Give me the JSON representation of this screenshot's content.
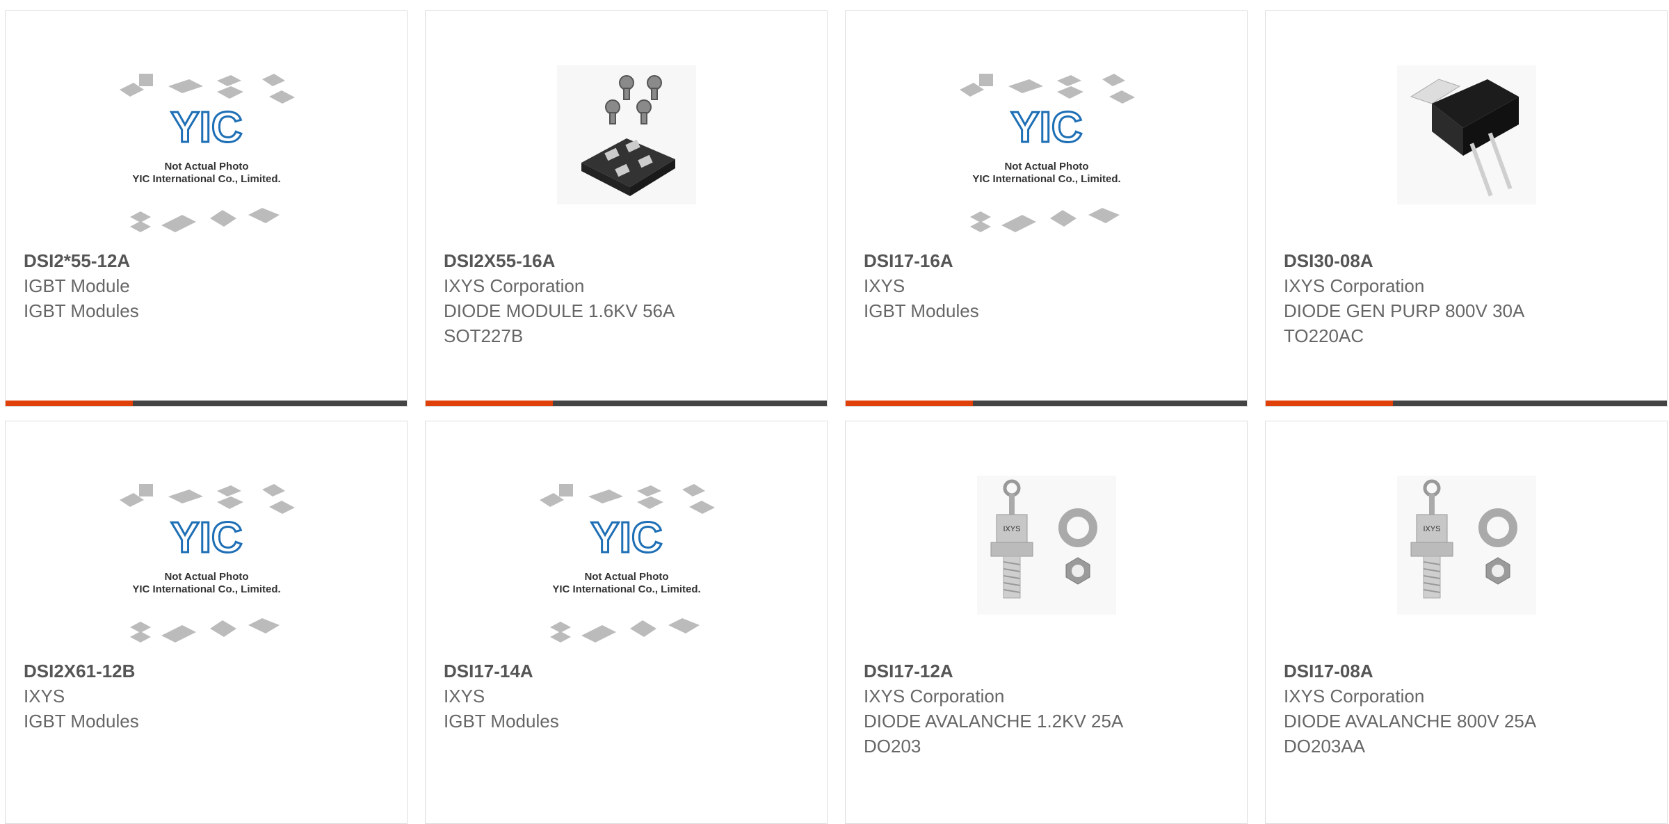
{
  "colors": {
    "accent": "#e0400a",
    "bar": "#444444",
    "text": "#666666",
    "border": "#dddddd",
    "logo": "#1e6fb5"
  },
  "placeholder": {
    "line1": "Not Actual Photo",
    "line2": "YIC International Co., Limited.",
    "logo_text": "YIC"
  },
  "cards": [
    {
      "part_number": "DSI2*55-12A",
      "manufacturer": "IGBT Module",
      "desc1": "IGBT Modules",
      "desc2": "",
      "image": "yic-placeholder"
    },
    {
      "part_number": "DSI2X55-16A",
      "manufacturer": "IXYS Corporation",
      "desc1": "DIODE MODULE 1.6KV 56A",
      "desc2": "SOT227B",
      "image": "sot227-module"
    },
    {
      "part_number": "DSI17-16A",
      "manufacturer": "IXYS",
      "desc1": "IGBT Modules",
      "desc2": "",
      "image": "yic-placeholder"
    },
    {
      "part_number": "DSI30-08A",
      "manufacturer": "IXYS Corporation",
      "desc1": "DIODE GEN PURP 800V 30A",
      "desc2": "TO220AC",
      "image": "to220-package"
    },
    {
      "part_number": "DSI2X61-12B",
      "manufacturer": "IXYS",
      "desc1": "IGBT Modules",
      "desc2": "",
      "image": "yic-placeholder"
    },
    {
      "part_number": "DSI17-14A",
      "manufacturer": "IXYS",
      "desc1": "IGBT Modules",
      "desc2": "",
      "image": "yic-placeholder"
    },
    {
      "part_number": "DSI17-12A",
      "manufacturer": "IXYS Corporation",
      "desc1": "DIODE AVALANCHE 1.2KV 25A",
      "desc2": "DO203",
      "image": "do203-stud"
    },
    {
      "part_number": "DSI17-08A",
      "manufacturer": "IXYS Corporation",
      "desc1": "DIODE AVALANCHE 800V 25A",
      "desc2": "DO203AA",
      "image": "do203-stud"
    }
  ]
}
